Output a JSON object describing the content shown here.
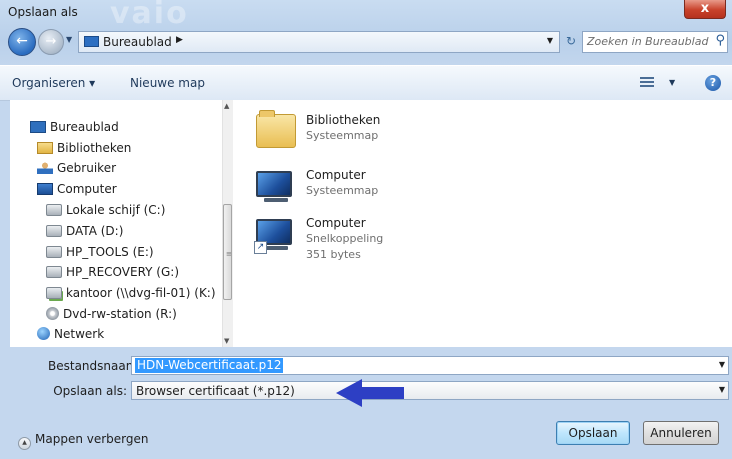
{
  "window": {
    "title": "Opslaan als",
    "watermark": "vaio",
    "close_symbol": "x"
  },
  "nav": {
    "back_symbol": "←",
    "forward_symbol": "→",
    "address": "Bureaublad",
    "search_placeholder": "Zoeken in Bureaublad"
  },
  "toolbar": {
    "organize": "Organiseren ▾",
    "new_folder": "Nieuwe map",
    "help": "?"
  },
  "sidebar": {
    "items": [
      {
        "label": "Bureaublad",
        "icon": "desktop-icon"
      },
      {
        "label": "Bibliotheken",
        "icon": "library-icon"
      },
      {
        "label": "Gebruiker",
        "icon": "user-icon"
      },
      {
        "label": "Computer",
        "icon": "computer-icon"
      },
      {
        "label": "Lokale schijf (C:)",
        "icon": "drive-icon"
      },
      {
        "label": "DATA (D:)",
        "icon": "drive-icon"
      },
      {
        "label": "HP_TOOLS (E:)",
        "icon": "drive-icon"
      },
      {
        "label": "HP_RECOVERY (G:)",
        "icon": "drive-icon"
      },
      {
        "label": "kantoor (\\\\dvg-fil-01) (K:)",
        "icon": "network-drive-icon"
      },
      {
        "label": "Dvd-rw-station (R:)",
        "icon": "dvd-icon"
      },
      {
        "label": "Netwerk",
        "icon": "network-icon"
      }
    ]
  },
  "files": [
    {
      "name": "Bibliotheken",
      "type": "Systeemmap",
      "icon": "folder-icon"
    },
    {
      "name": "Computer",
      "type": "Systeemmap",
      "icon": "computer-icon"
    },
    {
      "name": "Computer",
      "type": "Snelkoppeling",
      "size": "351 bytes",
      "icon": "computer-shortcut-icon"
    }
  ],
  "form": {
    "filename_label": "Bestandsnaam:",
    "filename_value": "HDN-Webcertificaat.p12",
    "savetype_label": "Opslaan als:",
    "savetype_value": "Browser certificaat (*.p12)"
  },
  "footer": {
    "hide_folders": "Mappen verbergen",
    "save": "Opslaan",
    "cancel": "Annuleren"
  },
  "colors": {
    "annotation_arrow": "#2d3fc4",
    "selection": "#3399ff"
  }
}
